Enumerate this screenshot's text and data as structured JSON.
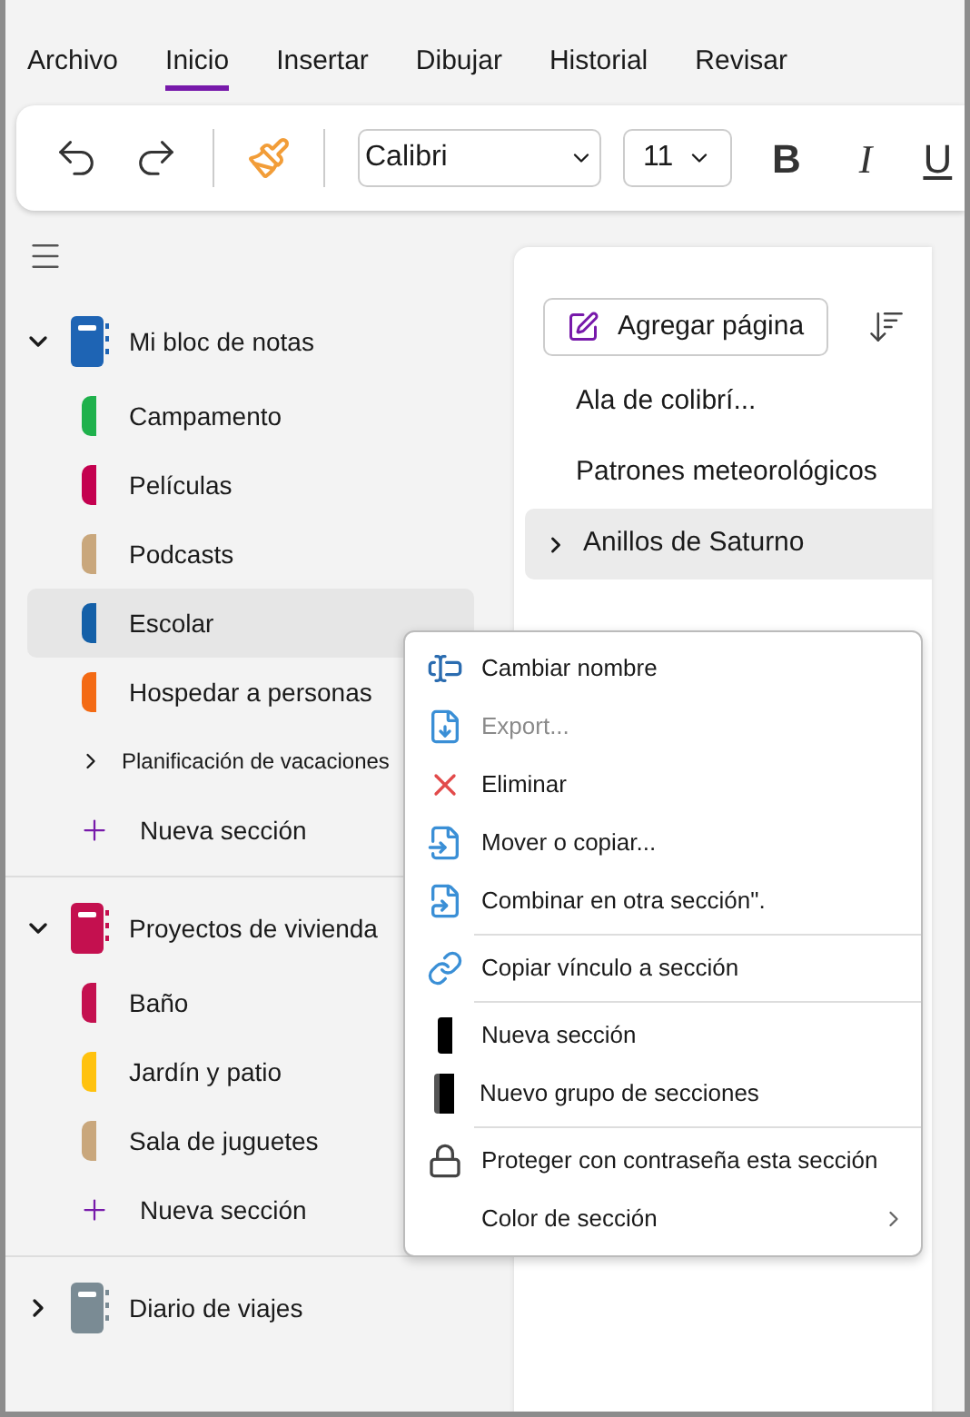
{
  "tabs": [
    {
      "label": "Archivo",
      "selected": false
    },
    {
      "label": "Inicio",
      "selected": true
    },
    {
      "label": "Insertar",
      "selected": false
    },
    {
      "label": "Dibujar",
      "selected": false
    },
    {
      "label": "Historial",
      "selected": false
    },
    {
      "label": "Revisar",
      "selected": false
    }
  ],
  "toolbar": {
    "font": "Calibri",
    "size": "11",
    "bold": "B",
    "italic": "I",
    "underline": "U"
  },
  "notebooks": [
    {
      "name": "Mi bloc de notas",
      "color": "#1e64b4",
      "expanded": true,
      "children": [
        {
          "kind": "section",
          "name": "Campamento",
          "color": "#1fb14c",
          "selected": false
        },
        {
          "kind": "section",
          "name": "Películas",
          "color": "#c4004f",
          "selected": false
        },
        {
          "kind": "section",
          "name": "Podcasts",
          "color": "#c9a77c",
          "selected": false
        },
        {
          "kind": "section",
          "name": "Escolar",
          "color": "#1460a8",
          "selected": true
        },
        {
          "kind": "section",
          "name": "Hospedar a personas",
          "color": "#f36a14",
          "selected": false
        },
        {
          "kind": "group",
          "name": "Planificación de vacaciones",
          "expanded": false
        },
        {
          "kind": "new",
          "name": "Nueva sección"
        }
      ]
    },
    {
      "name": "Proyectos de vivienda",
      "color": "#c4104f",
      "expanded": true,
      "children": [
        {
          "kind": "section",
          "name": "Baño",
          "color": "#c4104f",
          "selected": false
        },
        {
          "kind": "section",
          "name": "Jardín y patio",
          "color": "#ffc20e",
          "selected": false
        },
        {
          "kind": "section",
          "name": "Sala de juguetes",
          "color": "#c9a77c",
          "selected": false
        },
        {
          "kind": "new",
          "name": "Nueva sección"
        }
      ]
    },
    {
      "name": "Diario de viajes",
      "color": "#7a8b94",
      "expanded": false
    }
  ],
  "add_page": "Agregar página",
  "pages": [
    {
      "kind": "page",
      "title": "Ala de colibrí...",
      "selected": false
    },
    {
      "kind": "page",
      "title": "Patrones meteorológicos",
      "selected": false
    },
    {
      "kind": "group",
      "title": "Anillos de Saturno",
      "selected": true
    }
  ],
  "context_menu": [
    {
      "kind": "rename",
      "label": "Cambiar nombre",
      "disabled": false,
      "separator_before": false
    },
    {
      "kind": "export",
      "label": "Export...",
      "disabled": true,
      "separator_before": false
    },
    {
      "kind": "delete",
      "label": "Eliminar",
      "disabled": false,
      "separator_before": false
    },
    {
      "kind": "move",
      "label": "Mover o copiar...",
      "disabled": false,
      "separator_before": false
    },
    {
      "kind": "merge",
      "label": "Combinar en otra sección\".",
      "disabled": false,
      "separator_before": false
    },
    {
      "kind": "link",
      "label": "Copiar vínculo a sección",
      "disabled": false,
      "separator_before": true
    },
    {
      "kind": "new-section",
      "label": "Nueva sección",
      "disabled": false,
      "separator_before": true
    },
    {
      "kind": "new-group",
      "label": "Nuevo grupo de secciones",
      "disabled": false,
      "separator_before": false
    },
    {
      "kind": "password",
      "label": "Proteger con contraseña esta sección",
      "disabled": false,
      "separator_before": true
    },
    {
      "kind": "color",
      "label": "Color de sección",
      "disabled": false,
      "separator_before": false
    }
  ]
}
